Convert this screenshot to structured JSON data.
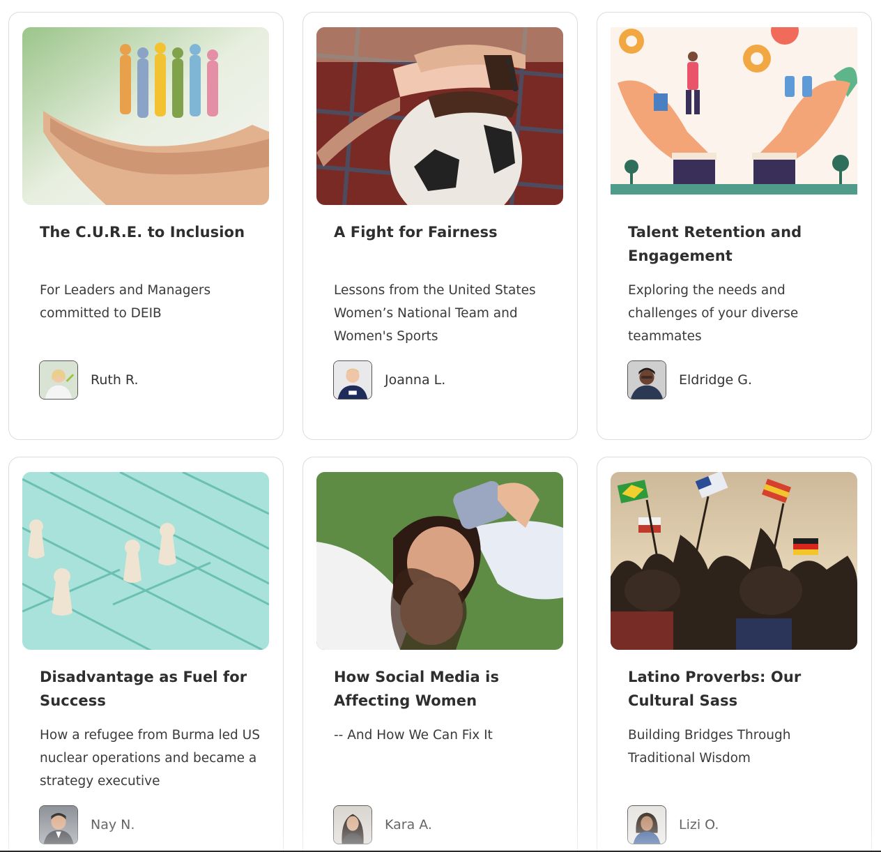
{
  "cards": [
    {
      "title": "The C.U.R.E. to Inclusion",
      "subtitle": "For Leaders and Managers committed to DEIB",
      "author": "Ruth R.",
      "image": "paper-people-in-hands"
    },
    {
      "title": "A Fight for Fairness",
      "subtitle": "Lessons from the United States Women’s National Team and Women's Sports",
      "author": "Joanna L.",
      "image": "hands-stacked-on-soccer-ball"
    },
    {
      "title": "Talent Retention and Engagement",
      "subtitle": "Exploring the needs and challenges of your diverse teammates",
      "author": "Eldridge G.",
      "image": "illustration-hands-holding-team"
    },
    {
      "title": "Disadvantage as Fuel for Success",
      "subtitle": "How a refugee from Burma led US nuclear operations and became a strategy executive",
      "author": "Nay N.",
      "image": "pawns-on-lines"
    },
    {
      "title": "How Social Media is Affecting Women",
      "subtitle": "-- And How We Can Fix It",
      "author": "Kara A.",
      "image": "women-selfie-on-grass"
    },
    {
      "title": "Latino Proverbs: Our Cultural Sass",
      "subtitle": "Building Bridges Through Traditional Wisdom",
      "author": "Lizi O.",
      "image": "crowd-waving-flags"
    }
  ]
}
